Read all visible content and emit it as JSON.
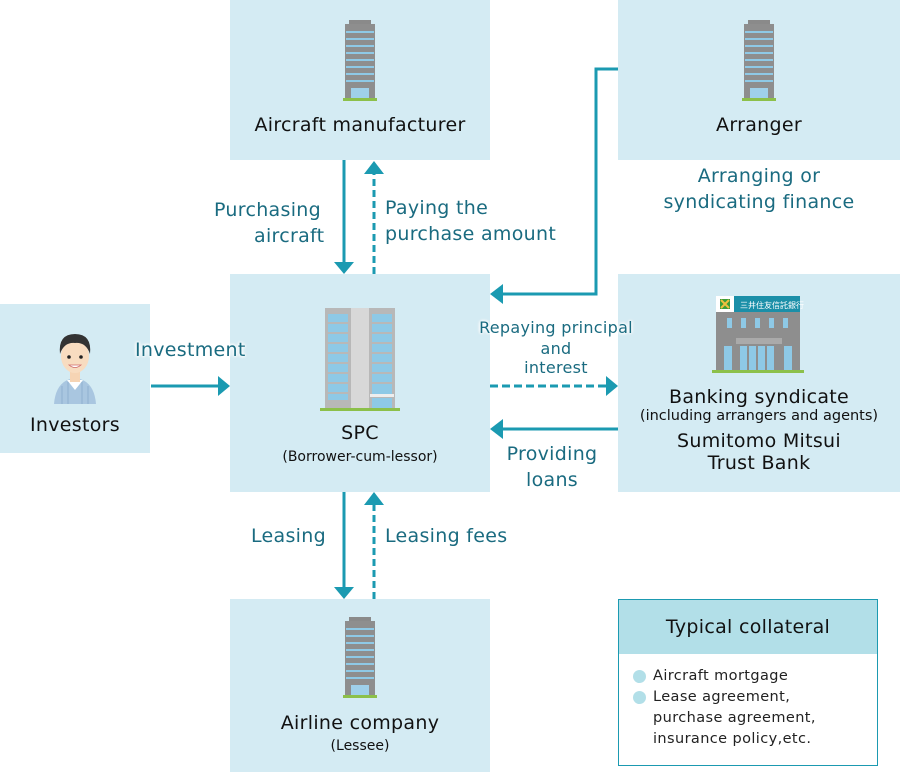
{
  "colors": {
    "box_fill": "#d4ebf3",
    "arrow": "#1b9ab1",
    "label_text": "#1a6b80",
    "collateral_header": "#b2dfe8"
  },
  "nodes": {
    "manufacturer": {
      "title": "Aircraft manufacturer",
      "icon": "office-building-icon"
    },
    "arranger": {
      "title": "Arranger",
      "icon": "office-building-icon"
    },
    "investors": {
      "title": "Investors",
      "icon": "person-avatar-icon"
    },
    "spc": {
      "title": "SPC",
      "subtitle": "(Borrower-cum-lessor)",
      "icon": "office-tower-icon"
    },
    "bank": {
      "title": "Banking syndicate",
      "subtitle": "(including arrangers and agents)",
      "name_line1": "Sumitomo Mitsui",
      "name_line2": "Trust Bank",
      "sign_text": "三井住友信託銀行",
      "icon": "bank-building-icon"
    },
    "airline": {
      "title": "Airline company",
      "subtitle": "(Lessee)",
      "icon": "office-building-icon"
    }
  },
  "flows": {
    "purchasing": {
      "line1": "Purchasing",
      "line2": "aircraft",
      "style": "solid",
      "direction": "manufacturer-to-spc"
    },
    "paying": {
      "line1": "Paying the",
      "line2": "purchase amount",
      "style": "dashed",
      "direction": "spc-to-manufacturer"
    },
    "arranging": {
      "line1": "Arranging or",
      "line2": "syndicating finance",
      "style": "solid",
      "direction": "arranger-to-spc"
    },
    "investment": {
      "label": "Investment",
      "style": "solid",
      "direction": "investors-to-spc"
    },
    "repaying": {
      "line1": "Repaying principal",
      "line2": "and",
      "line3": "interest",
      "style": "dashed",
      "direction": "spc-to-bank"
    },
    "providing": {
      "line1": "Providing",
      "line2": "loans",
      "style": "solid",
      "direction": "bank-to-spc"
    },
    "leasing": {
      "label": "Leasing",
      "style": "solid",
      "direction": "spc-to-airline"
    },
    "leasing_fees": {
      "label": "Leasing fees",
      "style": "dashed",
      "direction": "airline-to-spc"
    }
  },
  "collateral": {
    "title": "Typical collateral",
    "items": [
      {
        "line1": "Aircraft mortgage"
      },
      {
        "line1": "Lease agreement,",
        "line2": "purchase agreement,",
        "line3": "insurance policy,etc."
      }
    ]
  }
}
